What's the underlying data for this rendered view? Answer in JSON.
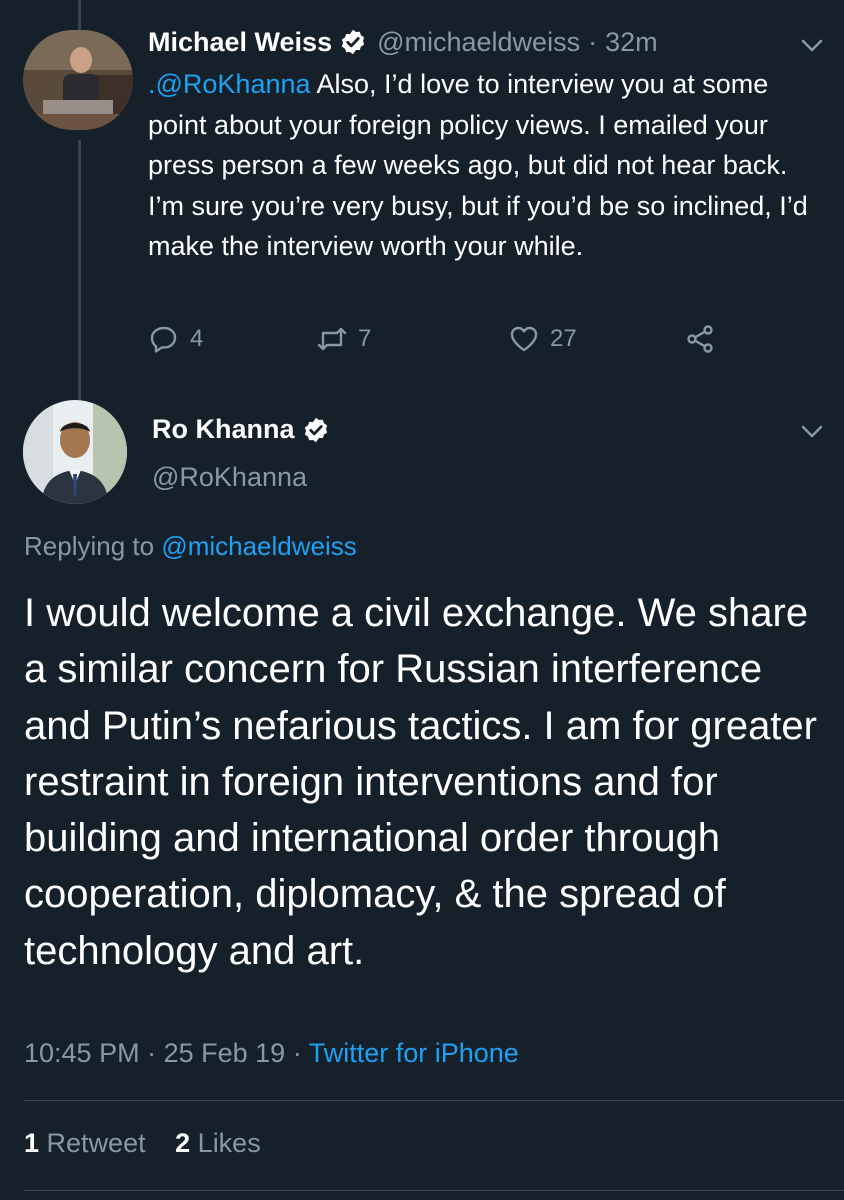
{
  "colors": {
    "background": "#15202b",
    "text": "#ffffff",
    "muted": "#8899a6",
    "link": "#1da1f2",
    "divider": "#38444d"
  },
  "tweet1": {
    "name": "Michael Weiss",
    "handle": "@michaeldweiss",
    "separator": "·",
    "time": "32m",
    "mention": ".@RoKhanna",
    "text": " Also, I’d love to interview you at some point about your foreign policy views. I emailed your press person a few weeks ago, but did not hear back. I’m sure you’re very busy, but if you’d be so inclined, I’d make the interview worth your while.",
    "replies": "4",
    "retweets": "7",
    "likes": "27"
  },
  "tweet2": {
    "name": "Ro Khanna",
    "handle": "@RoKhanna",
    "replying_label": "Replying to",
    "replying_to": "@michaeldweiss",
    "text": "I would welcome a civil exchange. We share a similar concern for Russian interference and Putin’s nefarious tactics. I am for greater restraint in foreign interventions and for building and international order through cooperation, diplomacy, & the spread of technology and art.",
    "time": "10:45 PM",
    "date": "25 Feb 19",
    "source": "Twitter for iPhone",
    "retweet_count": "1",
    "retweet_label": "Retweet",
    "like_count": "2",
    "like_label": "Likes"
  }
}
